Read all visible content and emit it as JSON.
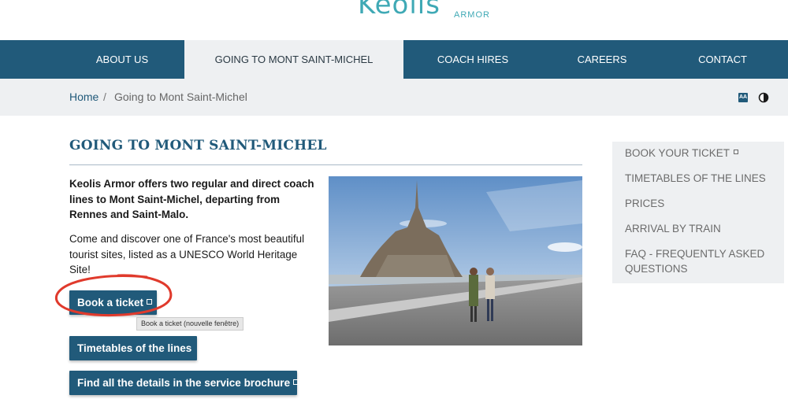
{
  "logo": {
    "main": "Keolis",
    "sub": "ARMOR"
  },
  "nav": {
    "items": [
      {
        "label": "ABOUT US"
      },
      {
        "label": "GOING TO MONT SAINT-MICHEL"
      },
      {
        "label": "COACH HIRES"
      },
      {
        "label": "CAREERS"
      },
      {
        "label": "CONTACT"
      }
    ]
  },
  "breadcrumb": {
    "home": "Home",
    "separator": "/",
    "current": "Going to Mont Saint-Michel"
  },
  "tools": {
    "text_size_label": "AA",
    "contrast_icon": "contrast-icon"
  },
  "main": {
    "title": "GOING TO MONT SAINT-MICHEL",
    "intro": "Keolis Armor offers two regular and direct coach lines to Mont Saint-Michel, departing from Rennes and Saint-Malo.",
    "description": "Come and discover one of France's most beautiful tourist sites, listed as a UNESCO World Heritage Site!",
    "buttons": {
      "book": "Book a ticket",
      "timetables": "Timetables of the lines",
      "brochure": "Find all the details in the service brochure"
    },
    "tooltip": "Book a ticket (nouvelle fenêtre)"
  },
  "sidebar": {
    "items": [
      {
        "label": "BOOK YOUR TICKET"
      },
      {
        "label": "TIMETABLES OF THE LINES"
      },
      {
        "label": "PRICES"
      },
      {
        "label": "ARRIVAL BY TRAIN"
      },
      {
        "label": "FAQ - FREQUENTLY ASKED QUESTIONS"
      }
    ]
  },
  "colors": {
    "brand_blue": "#215a7a",
    "logo_teal": "#3fa9b5",
    "light_gray": "#eef0f2",
    "annotation_red": "#e03a2c"
  }
}
